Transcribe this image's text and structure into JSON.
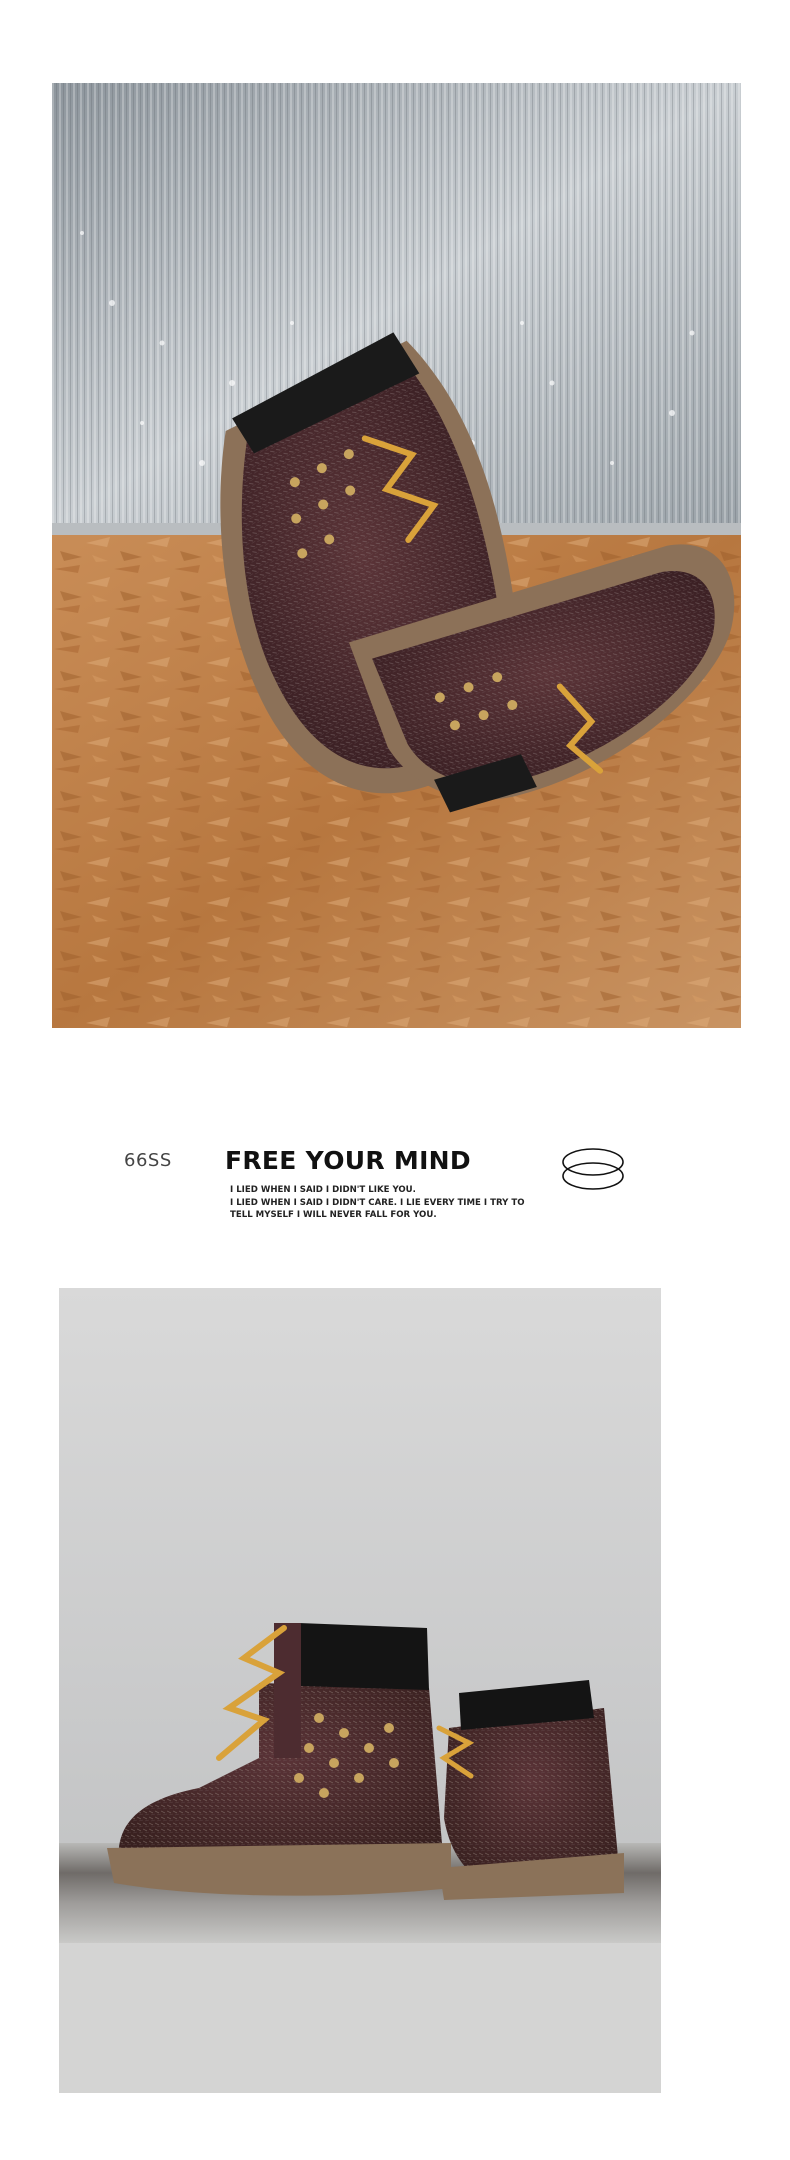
{
  "tagline": {
    "brand_code": "66SS",
    "headline": "FREE YOUR MIND",
    "quote_lines": [
      "I LIED WHEN I SAID I DIDN'T LIKE YOU.",
      "I LIED WHEN I SAID I DIDN'T CARE. I LIE EVERY TIME I TRY TO",
      "TELL MYSELF I WILL NEVER FALL FOR YOU."
    ]
  },
  "colors": {
    "suede": "#4a2a2c",
    "sole": "#8a7158",
    "laces": "#d9a23a",
    "wood": "#c48a55",
    "collar": "#1a1a1a"
  },
  "icons": [
    "double-ring-logo-icon"
  ]
}
